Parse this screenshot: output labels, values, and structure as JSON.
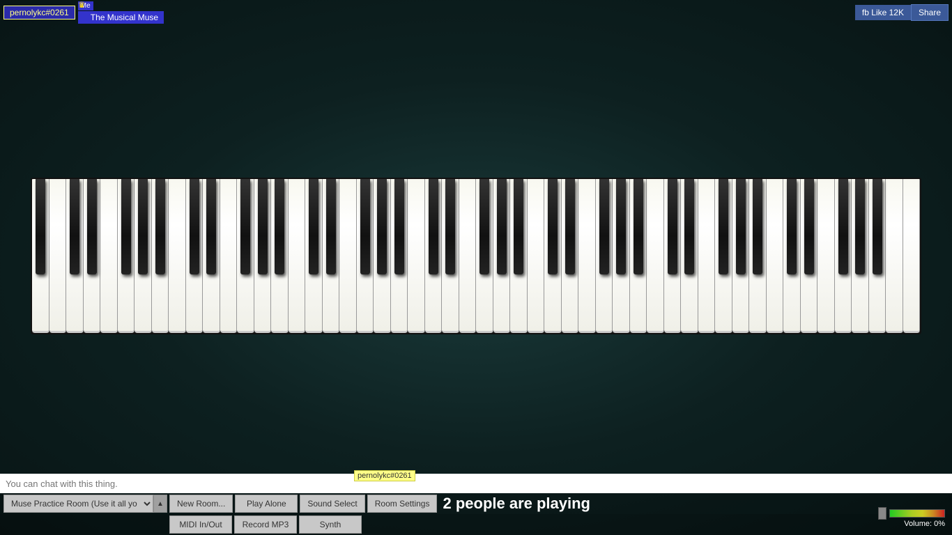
{
  "header": {
    "username": "pernolykc#0261",
    "me_label": "Me",
    "room_name": "The Musical Muse",
    "crown": "♛",
    "fb_like": "fb Like 12K",
    "fb_share": "Share"
  },
  "piano": {
    "white_keys_count": 52,
    "octaves": 7
  },
  "chat": {
    "placeholder": "You can chat with this thing.",
    "cursor_tooltip": "pernolykc#0261"
  },
  "controls": {
    "room_select_value": "Muse Practice Room (Use it all you li",
    "new_room": "New Room...",
    "play_alone": "Play Alone",
    "sound_select": "Sound Select",
    "room_settings": "Room Settings",
    "midi_in_out": "MIDI In/Out",
    "record_mp3": "Record MP3",
    "synth": "Synth"
  },
  "status": {
    "players_count": "2",
    "players_label": "people are playing"
  },
  "volume": {
    "label": "Volume: 0%"
  }
}
